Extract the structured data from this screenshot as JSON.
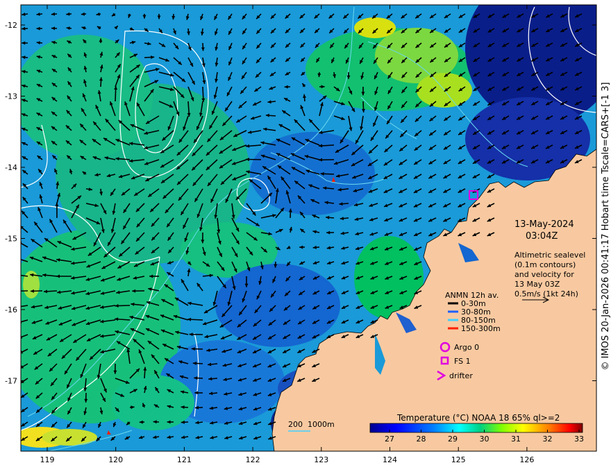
{
  "map": {
    "lon_ticks": [
      "119",
      "120",
      "121",
      "122",
      "123",
      "124",
      "125",
      "126"
    ],
    "lat_ticks": [
      "-12",
      "-13",
      "-14",
      "-15",
      "-16",
      "-17"
    ]
  },
  "info": {
    "date": "13-May-2024",
    "time": "03:04Z",
    "description": [
      "Altimetric sealevel",
      "(0.1m contours)",
      "and velocity for",
      "13 May 03Z",
      "0.5m/s (1kt 24h)"
    ]
  },
  "legend": {
    "title": "ANMN 12h av.",
    "depths": [
      {
        "label": "0-30m",
        "color": "#000000"
      },
      {
        "label": "30-80m",
        "color": "#1f5fff"
      },
      {
        "label": "80-150m",
        "color": "#40d0ff"
      },
      {
        "label": "150-300m",
        "color": "#ff2000"
      }
    ],
    "platforms": [
      {
        "label": "Argo 0",
        "symbol": "circle"
      },
      {
        "label": "FS 1",
        "symbol": "square"
      },
      {
        "label": "drifter",
        "symbol": "chevron"
      }
    ]
  },
  "colorbar": {
    "title": "Temperature (°C) NOAA 18 65% ql>=2",
    "ticks": [
      "27",
      "28",
      "29",
      "30",
      "31",
      "32",
      "33"
    ],
    "colors": [
      "#00008f",
      "#0000ff",
      "#0080ff",
      "#00ffff",
      "#00d080",
      "#80ff00",
      "#ffff00",
      "#ff8000",
      "#ff0000",
      "#800000"
    ]
  },
  "bathymetry_label": "200  1000m",
  "caption": "© IMOS 20-Jan-2026 00:41:17 Hobart time Tscale=CARS+[-1 3]"
}
